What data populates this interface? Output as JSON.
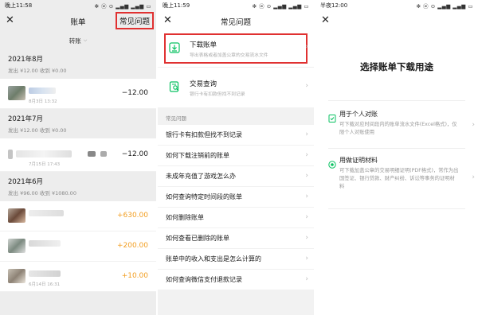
{
  "panel1": {
    "status_time": "晚上11:58",
    "status_right": "✻ ⓦ ⊙ ▂▄▆ ▂▄▆ ▭",
    "nav_title": "账单",
    "faq_button": "常见问题",
    "filter_label": "转账",
    "groups": [
      {
        "month": "2021年8月",
        "summary": "发出 ¥12.00  收到 ¥0.00",
        "items": [
          {
            "date": "8月3日 13:32",
            "amount": "−12.00",
            "type": "out"
          }
        ]
      },
      {
        "month": "2021年7月",
        "summary": "发出 ¥12.00  收到 ¥0.00",
        "items": [
          {
            "date": "7月15日 17:43",
            "amount": "−12.00",
            "type": "out"
          }
        ]
      },
      {
        "month": "2021年6月",
        "summary": "发出 ¥96.00  收到 ¥1080.00",
        "items": [
          {
            "date": "",
            "amount": "+630.00",
            "type": "in"
          },
          {
            "date": "",
            "amount": "+200.00",
            "type": "in"
          },
          {
            "date": "6月14日 16:31",
            "amount": "+10.00",
            "type": "in"
          }
        ]
      }
    ]
  },
  "panel2": {
    "status_time": "晚上11:59",
    "status_right": "✻ ⓦ ⊙ ▂▄▆ ▂▄▆ ▭",
    "nav_title": "常见问题",
    "download": {
      "title": "下载账单",
      "subtitle": "导出表格或者加盖公章的交易流水文件"
    },
    "query": {
      "title": "交易查询",
      "subtitle": "银行卡有扣款但找不到记录"
    },
    "section_title": "常见问题",
    "faqs": [
      "银行卡有扣款但找不到记录",
      "如何下载注销前的账单",
      "未成年充值了游戏怎么办",
      "如何查询特定时间段的账单",
      "如何删除账单",
      "如何查看已删除的账单",
      "账单中的收入和支出是怎么计算的",
      "如何查询微信支付退款记录"
    ]
  },
  "panel3": {
    "status_time": "半夜12:00",
    "status_right": "✻ ⓦ ⊙ ▂▄▆ ▂▄▆ ▭",
    "title": "选择账单下载用途",
    "opt1": {
      "title": "用于个人对账",
      "desc": "可下载对应时间段内的账单流水文件(Excel格式)，仅限个人对账使用"
    },
    "opt2": {
      "title": "用做证明材料",
      "desc": "可下载加盖公章的交易明细证明(PDF格式)，常作为出国签证、银行贷款、财产纠纷、诉讼等事务的证明材料"
    }
  },
  "colors": {
    "accent_green": "#07c160",
    "highlight_red": "#e03131",
    "income_orange": "#f29d1f"
  }
}
